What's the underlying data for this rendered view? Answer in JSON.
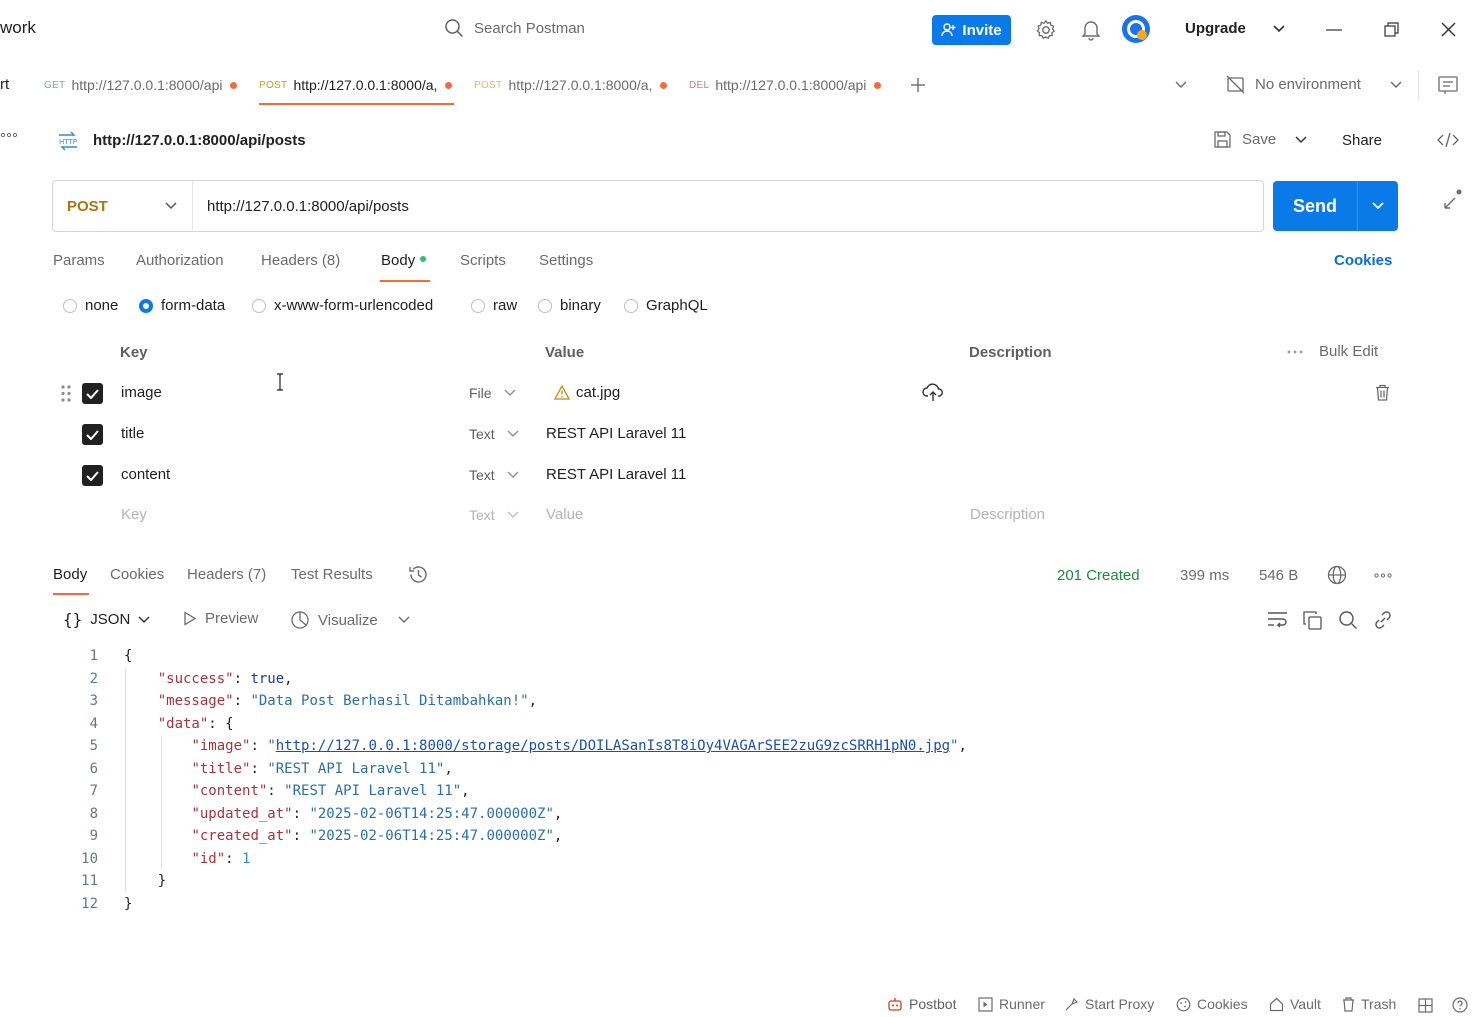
{
  "header": {
    "workspace_title": "work",
    "search_placeholder": "Search Postman",
    "invite_label": "Invite",
    "upgrade_label": "Upgrade"
  },
  "tabs": {
    "left_fragment": "rt",
    "items": [
      {
        "method": "GET",
        "url": "http://127.0.0.1:8000/api"
      },
      {
        "method": "POST",
        "url": "http://127.0.0.1:8000/a,"
      },
      {
        "method": "POST",
        "url": "http://127.0.0.1:8000/a,"
      },
      {
        "method": "DEL",
        "url": "http://127.0.0.1:8000/api"
      }
    ],
    "environment": "No environment"
  },
  "request": {
    "title": "http://127.0.0.1:8000/api/posts",
    "save_label": "Save",
    "share_label": "Share",
    "method": "POST",
    "url": "http://127.0.0.1:8000/api/posts",
    "send_label": "Send",
    "subtabs": {
      "params": "Params",
      "authorization": "Authorization",
      "headers": "Headers",
      "headers_count": "(8)",
      "body": "Body",
      "scripts": "Scripts",
      "settings": "Settings",
      "cookies": "Cookies"
    },
    "body_types": {
      "none": "none",
      "form_data": "form-data",
      "urlencoded": "x-www-form-urlencoded",
      "raw": "raw",
      "binary": "binary",
      "graphql": "GraphQL"
    },
    "table": {
      "col_key": "Key",
      "col_value": "Value",
      "col_description": "Description",
      "bulk_edit": "Bulk Edit",
      "rows": [
        {
          "key": "image",
          "type": "File",
          "value": "cat.jpg"
        },
        {
          "key": "title",
          "type": "Text",
          "value": "REST API Laravel 11"
        },
        {
          "key": "content",
          "type": "Text",
          "value": "REST API Laravel 11"
        }
      ],
      "placeholder": {
        "key": "Key",
        "type": "Text",
        "value": "Value",
        "description": "Description"
      }
    }
  },
  "response": {
    "tabs": {
      "body": "Body",
      "cookies": "Cookies",
      "headers": "Headers",
      "headers_count": "(7)",
      "test_results": "Test Results"
    },
    "status": "201 Created",
    "time": "399 ms",
    "size": "546 B",
    "format": "JSON",
    "preview": "Preview",
    "visualize": "Visualize",
    "lines": {
      "l1": "{",
      "k_success": "\"success\"",
      "v_success": "true",
      "k_message": "\"message\"",
      "v_message": "\"Data Post Berhasil Ditambahkan!\"",
      "k_data": "\"data\"",
      "k_image": "\"image\"",
      "v_image_url": "http://127.0.0.1:8000/storage/posts/DOILASanIs8T8iOy4VAGArSEE2zuG9zcSRRH1pN0.jpg",
      "k_title": "\"title\"",
      "v_title": "\"REST API Laravel 11\"",
      "k_content": "\"content\"",
      "v_content": "\"REST API Laravel 11\"",
      "k_updated": "\"updated_at\"",
      "v_updated": "\"2025-02-06T14:25:47.000000Z\"",
      "k_created": "\"created_at\"",
      "v_created": "\"2025-02-06T14:25:47.000000Z\"",
      "k_id": "\"id\"",
      "v_id": "1"
    }
  },
  "footer": {
    "postbot": "Postbot",
    "runner": "Runner",
    "start_proxy": "Start Proxy",
    "cookies": "Cookies",
    "vault": "Vault",
    "trash": "Trash"
  }
}
